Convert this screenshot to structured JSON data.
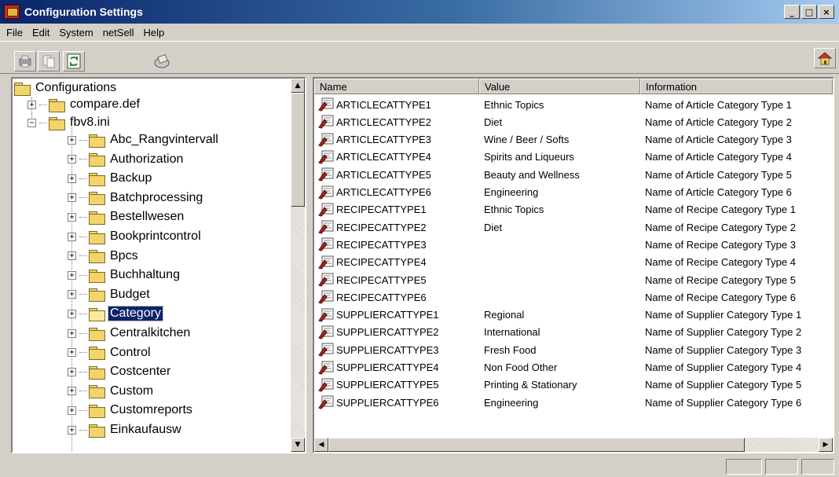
{
  "window": {
    "title": "Configuration Settings",
    "buttons": [
      "_",
      "□",
      "×"
    ]
  },
  "menu": [
    "File",
    "Edit",
    "System",
    "netSell",
    "Help"
  ],
  "tree": {
    "root": "Configurations",
    "files": [
      "compare.def",
      "fbv8.ini"
    ],
    "folders": [
      "Abc_Rangvintervall",
      "Authorization",
      "Backup",
      "Batchprocessing",
      "Bestellwesen",
      "Bookprintcontrol",
      "Bpcs",
      "Buchhaltung",
      "Budget",
      "Category",
      "Centralkitchen",
      "Control",
      "Costcenter",
      "Custom",
      "Customreports",
      "Einkaufausw"
    ],
    "selected": "Category"
  },
  "list": {
    "columns": [
      "Name",
      "Value",
      "Information"
    ],
    "rows": [
      {
        "name": "ARTICLECATTYPE1",
        "value": "Ethnic Topics",
        "info": "Name of Article Category Type 1"
      },
      {
        "name": "ARTICLECATTYPE2",
        "value": "Diet",
        "info": "Name of Article Category Type 2"
      },
      {
        "name": "ARTICLECATTYPE3",
        "value": "Wine / Beer / Softs",
        "info": "Name of Article Category Type 3"
      },
      {
        "name": "ARTICLECATTYPE4",
        "value": "Spirits and Liqueurs",
        "info": "Name of Article Category Type 4"
      },
      {
        "name": "ARTICLECATTYPE5",
        "value": "Beauty and Wellness",
        "info": "Name of Article Category Type 5"
      },
      {
        "name": "ARTICLECATTYPE6",
        "value": "Engineering",
        "info": "Name of Article Category Type 6"
      },
      {
        "name": "RECIPECATTYPE1",
        "value": "Ethnic Topics",
        "info": "Name of Recipe Category Type 1"
      },
      {
        "name": "RECIPECATTYPE2",
        "value": "Diet",
        "info": "Name of Recipe Category Type 2"
      },
      {
        "name": "RECIPECATTYPE3",
        "value": "",
        "info": "Name of Recipe Category Type 3"
      },
      {
        "name": "RECIPECATTYPE4",
        "value": "",
        "info": "Name of Recipe Category Type 4"
      },
      {
        "name": "RECIPECATTYPE5",
        "value": "",
        "info": "Name of Recipe Category Type 5"
      },
      {
        "name": "RECIPECATTYPE6",
        "value": "",
        "info": "Name of Recipe Category Type 6"
      },
      {
        "name": "SUPPLIERCATTYPE1",
        "value": "Regional",
        "info": "Name of Supplier Category Type 1"
      },
      {
        "name": "SUPPLIERCATTYPE2",
        "value": "International",
        "info": "Name of Supplier Category Type 2"
      },
      {
        "name": "SUPPLIERCATTYPE3",
        "value": "Fresh Food",
        "info": "Name of Supplier Category Type 3"
      },
      {
        "name": "SUPPLIERCATTYPE4",
        "value": "Non Food Other",
        "info": "Name of Supplier Category Type 4"
      },
      {
        "name": "SUPPLIERCATTYPE5",
        "value": "Printing & Stationary",
        "info": "Name of Supplier Category Type 5"
      },
      {
        "name": "SUPPLIERCATTYPE6",
        "value": "Engineering",
        "info": "Name of Supplier Category Type 6"
      }
    ]
  },
  "icons": {
    "app": "app-icon",
    "toolbar": [
      "print-icon",
      "copy-icon",
      "refresh-icon",
      "settings-icon",
      "home-icon"
    ],
    "folder": "folder-icon",
    "entry": "key-value-icon"
  },
  "colors": {
    "titlebar_start": "#0a246a",
    "titlebar_end": "#a6caf0",
    "selection": "#0a246a",
    "face": "#d4d0c8"
  }
}
